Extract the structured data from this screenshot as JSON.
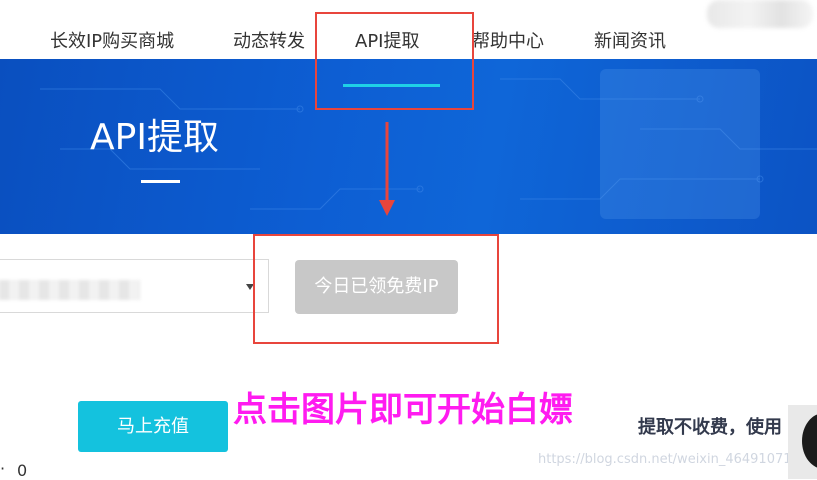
{
  "nav": {
    "items": [
      "长效IP购买商城",
      "动态转发",
      "API提取",
      "帮助中心",
      "新闻资讯"
    ],
    "active": "API提取"
  },
  "banner": {
    "title": "API提取"
  },
  "form": {
    "free_button": "今日已领免费IP",
    "recharge_button": "马上充值"
  },
  "annotation": {
    "text": "点击图片即可开始白嫖"
  },
  "notice": {
    "text": "提取不收费，使用"
  },
  "watermark": {
    "text": "https://blog.csdn.net/weixin_46491071"
  },
  "misc": {
    "zero": "0",
    "dot": "·"
  },
  "colors": {
    "accent": "#14c2de",
    "underline": "#1fd1e6",
    "banner": "#0d5ed3",
    "annotation": "#ff1bf0",
    "highlight_box": "#e8453c",
    "disabled_button": "#c8c8c8"
  }
}
